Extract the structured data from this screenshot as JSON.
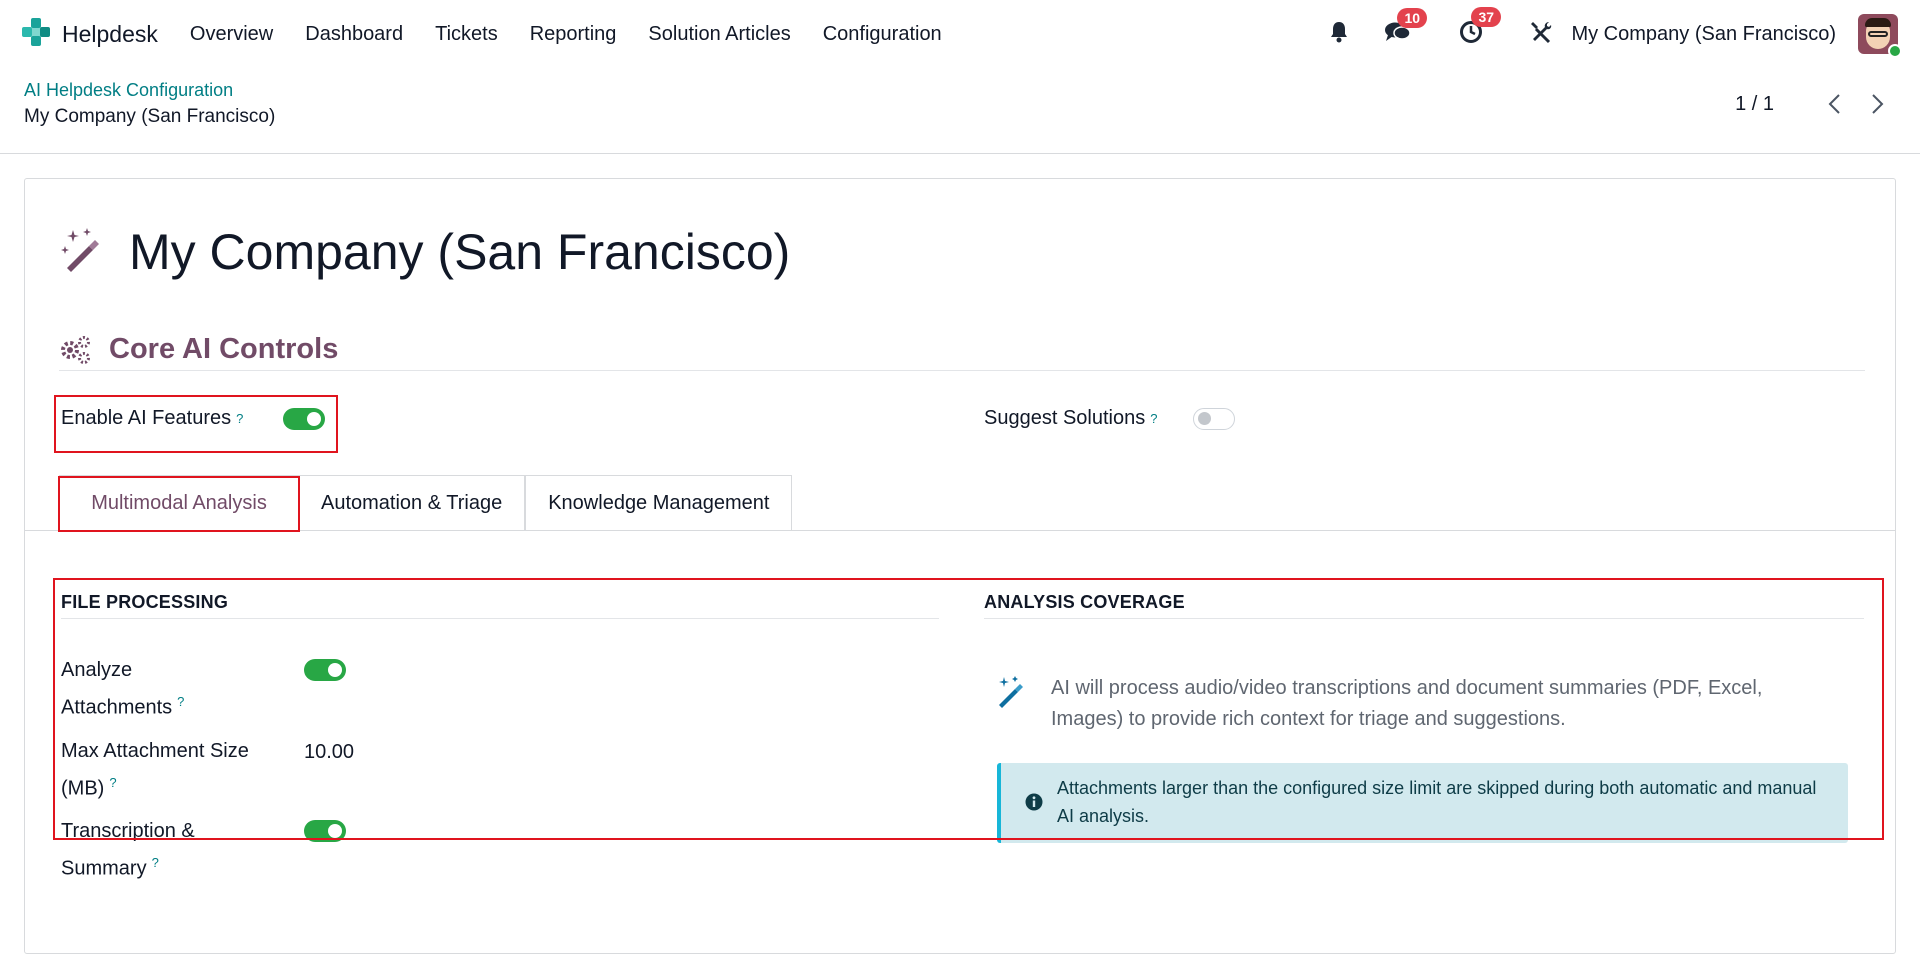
{
  "app": {
    "brand": "Helpdesk",
    "menu": [
      "Overview",
      "Dashboard",
      "Tickets",
      "Reporting",
      "Solution Articles",
      "Configuration"
    ],
    "messages_count": "10",
    "activities_count": "37",
    "company": "My Company (San Francisco)"
  },
  "breadcrumb": {
    "parent": "AI Helpdesk Configuration",
    "current": "My Company (San Francisco)"
  },
  "pager": {
    "value": "1 / 1"
  },
  "record": {
    "title": "My Company (San Francisco)",
    "section_title": "Core AI Controls",
    "enable_ai": {
      "label": "Enable AI Features",
      "help": "?",
      "enabled": true
    },
    "suggest_solutions": {
      "label": "Suggest Solutions",
      "help": "?",
      "enabled": false
    },
    "tabs": [
      {
        "label": "Multimodal Analysis",
        "active": true
      },
      {
        "label": "Automation & Triage",
        "active": false
      },
      {
        "label": "Knowledge Management",
        "active": false
      }
    ],
    "file_processing": {
      "title": "FILE PROCESSING",
      "analyze_attachments": {
        "label_line1": "Analyze",
        "label_line2": "Attachments",
        "help": "?",
        "enabled": true
      },
      "max_size": {
        "label_line1": "Max Attachment Size",
        "label_line2": "(MB)",
        "help": "?",
        "value": "10.00"
      },
      "transcription": {
        "label_line1": "Transcription &",
        "label_line2": "Summary",
        "help": "?",
        "enabled": true
      }
    },
    "analysis_coverage": {
      "title": "ANALYSIS COVERAGE",
      "description": "AI will process audio/video transcriptions and document summaries (PDF, Excel, Images) to provide rich context for triage and suggestions.",
      "alert": "Attachments larger than the configured size limit are skipped during both automatic and manual AI analysis."
    }
  },
  "colors": {
    "accent": "#714b67",
    "link": "#017e84",
    "toggle_on": "#28a745",
    "badge": "#e3424d",
    "highlight": "#e0141e",
    "alert_bg": "#d2e9ee"
  }
}
